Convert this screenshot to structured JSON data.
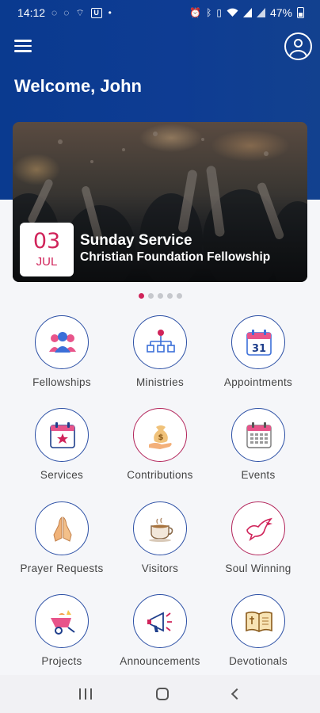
{
  "status_bar": {
    "time": "14:12",
    "battery": "47%",
    "left_icons": [
      "whatsapp-icon",
      "whatsapp-icon",
      "signal-app-icon",
      "u-app-icon",
      "dot-icon"
    ],
    "right_icons": [
      "alarm-icon",
      "bluetooth-icon",
      "vibrate-icon",
      "wifi-icon",
      "cell-signal-icon",
      "cell-signal-icon",
      "battery-icon"
    ]
  },
  "header": {
    "welcome_text": "Welcome, John",
    "menu_icon": "hamburger-menu-icon",
    "profile_icon": "user-profile-icon"
  },
  "banner": {
    "day": "03",
    "month": "JUL",
    "title": "Sunday Service",
    "subtitle": "Christian Foundation Fellowship",
    "slide_count": 5,
    "active_slide": 1
  },
  "menu": [
    {
      "label": "Fellowships",
      "icon": "group-people-icon"
    },
    {
      "label": "Ministries",
      "icon": "org-chart-icon"
    },
    {
      "label": "Appointments",
      "icon": "calendar-31-icon"
    },
    {
      "label": "Services",
      "icon": "calendar-star-icon"
    },
    {
      "label": "Contributions",
      "icon": "money-bag-hand-icon"
    },
    {
      "label": "Events",
      "icon": "calendar-grid-icon"
    },
    {
      "label": "Prayer Requests",
      "icon": "praying-hands-icon"
    },
    {
      "label": "Visitors",
      "icon": "coffee-cup-icon"
    },
    {
      "label": "Soul Winning",
      "icon": "dove-icon"
    },
    {
      "label": "Projects",
      "icon": "wheelbarrow-icon"
    },
    {
      "label": "Announcements",
      "icon": "megaphone-icon"
    },
    {
      "label": "Devotionals",
      "icon": "bible-book-icon"
    }
  ],
  "colors": {
    "header_blue": "#0e3c93",
    "accent_pink": "#d0245a",
    "circle_blue": "#2b4fa5"
  },
  "nav_bar": [
    "recent-apps-icon",
    "home-icon",
    "back-icon"
  ]
}
